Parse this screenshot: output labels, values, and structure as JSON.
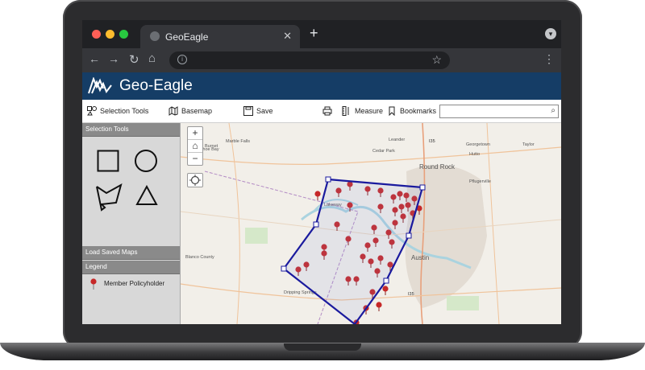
{
  "browser": {
    "tab_title": "GeoEagle",
    "tab_close": "✕",
    "new_tab": "+",
    "controls": {
      "back": "←",
      "forward": "→",
      "reload": "↻",
      "home": "⌂",
      "menu": "⋮"
    },
    "window_dots": [
      "#ff5f57",
      "#febc2e",
      "#28c840"
    ]
  },
  "app": {
    "title": "Geo-Eagle",
    "header_color": "#153d66"
  },
  "toolbar": {
    "selection_tools": "Selection Tools",
    "basemap": "Basemap",
    "save": "Save",
    "measure": "Measure",
    "bookmarks": "Bookmarks",
    "search_placeholder": ""
  },
  "panel": {
    "selection_tools_header": "Selection Tools",
    "shapes": [
      "square-icon",
      "circle-icon",
      "freehand-polygon-icon",
      "triangle-icon"
    ],
    "load_saved_maps": "Load Saved Maps",
    "legend_header": "Legend",
    "legend_items": [
      {
        "label": "Member Policyholder",
        "color": "#c62828"
      }
    ]
  },
  "map": {
    "places": [
      "Marble Falls",
      "Burnet",
      "Georgetown",
      "Leander",
      "Cedar Park",
      "Round Rock",
      "Hutto",
      "Taylor",
      "Pflugerville",
      "Lakeway",
      "Austin",
      "Dripping Springs",
      "Blanco County",
      "Horseshoe Bay"
    ],
    "selection_color": "#1a1a9e",
    "marker_color": "#c62828",
    "highway_labels": [
      "I35",
      "I35"
    ]
  }
}
